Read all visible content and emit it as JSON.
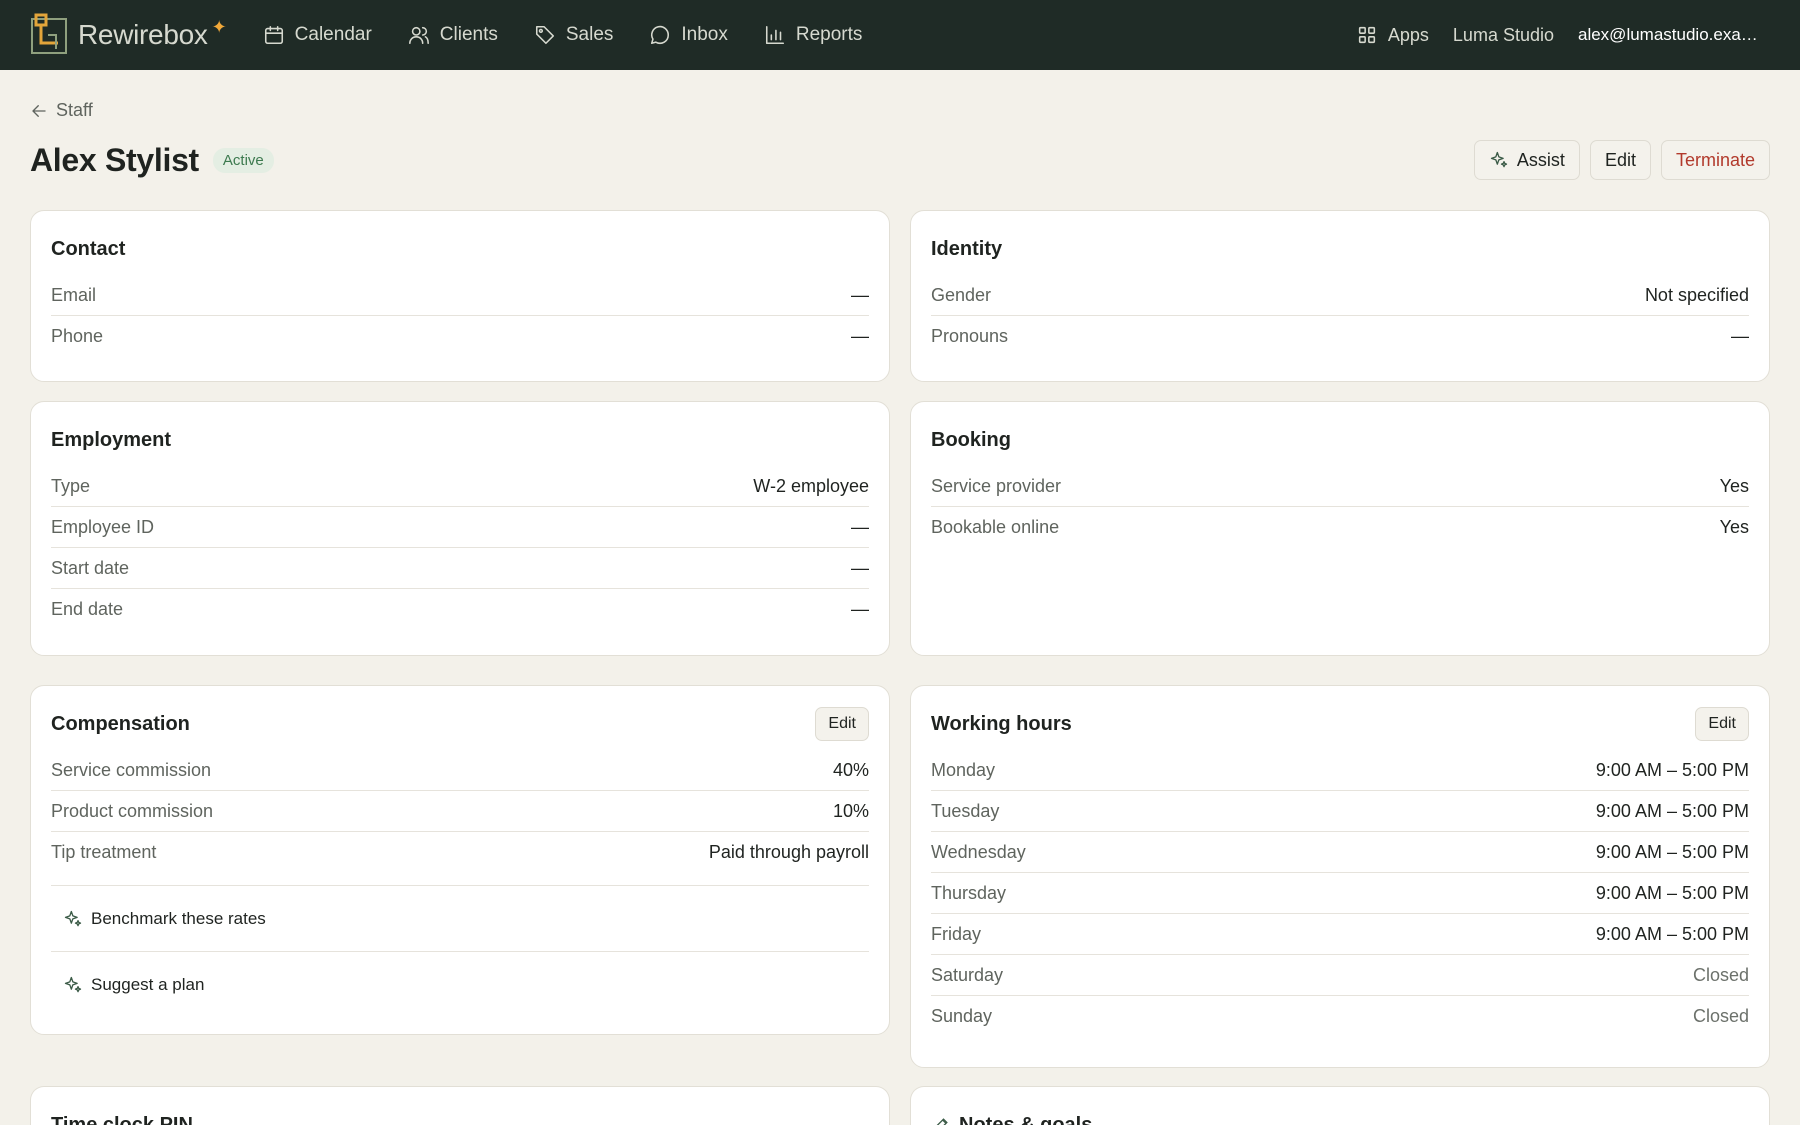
{
  "app": {
    "brand": "Rewirebox",
    "nav": [
      {
        "label": "Calendar",
        "icon": "calendar-icon"
      },
      {
        "label": "Clients",
        "icon": "users-icon"
      },
      {
        "label": "Sales",
        "icon": "tag-icon"
      },
      {
        "label": "Inbox",
        "icon": "chat-icon"
      },
      {
        "label": "Reports",
        "icon": "bar-chart-icon"
      }
    ],
    "apps_label": "Apps",
    "workspace": "Luma Studio",
    "user_email": "alex@lumastudio.example.com"
  },
  "header": {
    "back_label": "Staff",
    "title": "Alex Stylist",
    "status": "Active",
    "assist_label": "Assist",
    "edit_label": "Edit",
    "terminate_label": "Terminate"
  },
  "contact": {
    "title": "Contact",
    "rows": [
      {
        "label": "Email",
        "value": "—"
      },
      {
        "label": "Phone",
        "value": "—"
      }
    ]
  },
  "identity": {
    "title": "Identity",
    "rows": [
      {
        "label": "Gender",
        "value": "Not specified"
      },
      {
        "label": "Pronouns",
        "value": "—"
      }
    ]
  },
  "employment": {
    "title": "Employment",
    "rows": [
      {
        "label": "Type",
        "value": "W-2 employee"
      },
      {
        "label": "Employee ID",
        "value": "—"
      },
      {
        "label": "Start date",
        "value": "—"
      },
      {
        "label": "End date",
        "value": "—"
      }
    ]
  },
  "booking": {
    "title": "Booking",
    "rows": [
      {
        "label": "Service provider",
        "value": "Yes"
      },
      {
        "label": "Bookable online",
        "value": "Yes"
      }
    ]
  },
  "compensation": {
    "title": "Compensation",
    "edit_label": "Edit",
    "rows": [
      {
        "label": "Service commission",
        "value": "40%"
      },
      {
        "label": "Product commission",
        "value": "10%"
      },
      {
        "label": "Tip treatment",
        "value": "Paid through payroll"
      }
    ],
    "assist_links": [
      "Benchmark these rates",
      "Suggest a plan"
    ]
  },
  "working_hours": {
    "title": "Working hours",
    "edit_label": "Edit",
    "rows": [
      {
        "label": "Monday",
        "value": "9:00 AM – 5:00 PM"
      },
      {
        "label": "Tuesday",
        "value": "9:00 AM – 5:00 PM"
      },
      {
        "label": "Wednesday",
        "value": "9:00 AM – 5:00 PM"
      },
      {
        "label": "Thursday",
        "value": "9:00 AM – 5:00 PM"
      },
      {
        "label": "Friday",
        "value": "9:00 AM – 5:00 PM"
      },
      {
        "label": "Saturday",
        "value": "Closed"
      },
      {
        "label": "Sunday",
        "value": "Closed"
      }
    ]
  },
  "time_clock": {
    "title": "Time clock PIN"
  },
  "notes": {
    "title": "Notes & goals"
  }
}
